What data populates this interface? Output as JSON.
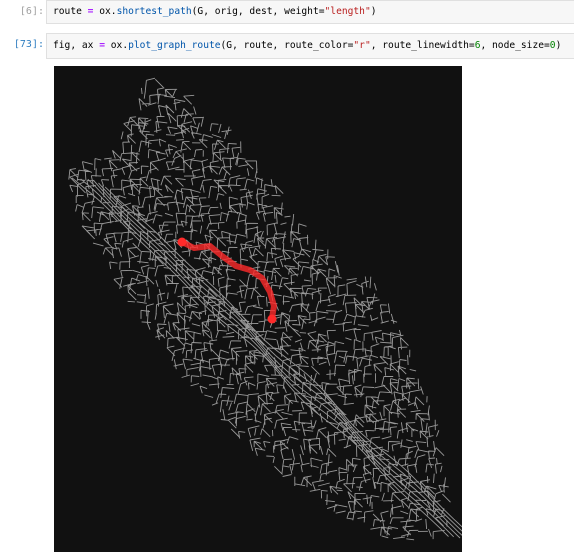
{
  "cells": [
    {
      "prompt": "[6]:",
      "code": {
        "lhs": "route",
        "eq": "=",
        "call_obj": "ox.",
        "call_fn": "shortest_path",
        "args_plain": "(G, orig, dest, weight=",
        "args_str": "\"length\"",
        "close": ")"
      }
    },
    {
      "prompt": "[73]:",
      "code": {
        "lhs": "fig, ax",
        "eq": "=",
        "call_obj": "ox.",
        "call_fn": "plot_graph_route",
        "args_plain_1": "(G, route, route_color=",
        "args_str": "\"r\"",
        "args_plain_2": ", route_linewidth=",
        "num1": "6",
        "args_plain_3": ", node_size=",
        "num2": "0",
        "close": ")"
      },
      "output": {
        "background": "#111111",
        "edge_color": "#999999",
        "route_color": "#ff2a2a"
      }
    }
  ]
}
